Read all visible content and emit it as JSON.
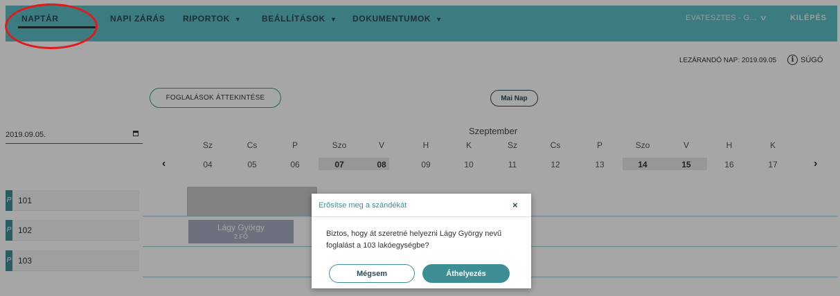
{
  "colors": {
    "accent": "#5dbdc4",
    "primary": "#3e8f95",
    "overview_border": "#3aa55b",
    "highlight": "#e01b1b"
  },
  "nav": {
    "items": [
      {
        "label": "NAPTÁR",
        "dropdown": false,
        "active": true
      },
      {
        "label": "NAPI ZÁRÁS",
        "dropdown": false
      },
      {
        "label": "RIPORTOK",
        "dropdown": true
      },
      {
        "label": "BEÁLLÍTÁSOK",
        "dropdown": true
      },
      {
        "label": "DOKUMENTUMOK",
        "dropdown": true
      }
    ],
    "user": "EVATESZTES - G...",
    "logout": "KILÉPÉS"
  },
  "status": {
    "closing_day": "LEZÁRANDÓ NAP: 2019.09.05"
  },
  "help": {
    "label": "SÚGÓ",
    "icon": "info-icon"
  },
  "toolbar": {
    "overview_label": "FOGLALÁSOK ÁTTEKINTÉSE",
    "today_label": "Mai Nap"
  },
  "date_field": {
    "value": "2019.09.05.",
    "icon": "calendar-icon"
  },
  "calendar": {
    "month": "Szeptember",
    "days": [
      {
        "name": "Sz",
        "num": "04"
      },
      {
        "name": "Cs",
        "num": "05"
      },
      {
        "name": "P",
        "num": "06"
      },
      {
        "name": "Szo",
        "num": "07",
        "weekend": true
      },
      {
        "name": "V",
        "num": "08",
        "weekend": true
      },
      {
        "name": "H",
        "num": "09"
      },
      {
        "name": "K",
        "num": "10"
      },
      {
        "name": "Sz",
        "num": "11"
      },
      {
        "name": "Cs",
        "num": "12"
      },
      {
        "name": "P",
        "num": "13"
      },
      {
        "name": "Szo",
        "num": "14",
        "weekend": true
      },
      {
        "name": "V",
        "num": "15",
        "weekend": true
      },
      {
        "name": "H",
        "num": "16"
      },
      {
        "name": "K",
        "num": "17"
      }
    ],
    "prev_arrow": "‹",
    "next_arrow": "›"
  },
  "rooms": [
    {
      "name": "101"
    },
    {
      "name": "102"
    },
    {
      "name": "103"
    }
  ],
  "booking": {
    "guest": "Lágy György",
    "persons": "2 FŐ"
  },
  "modal": {
    "title": "Erősítse meg a szándékát",
    "close": "×",
    "body": "Biztos, hogy át szeretné helyezni Lágy György nevű foglalást a 103 lakóegységbe?",
    "cancel_label": "Mégsem",
    "confirm_label": "Áthelyezés"
  }
}
